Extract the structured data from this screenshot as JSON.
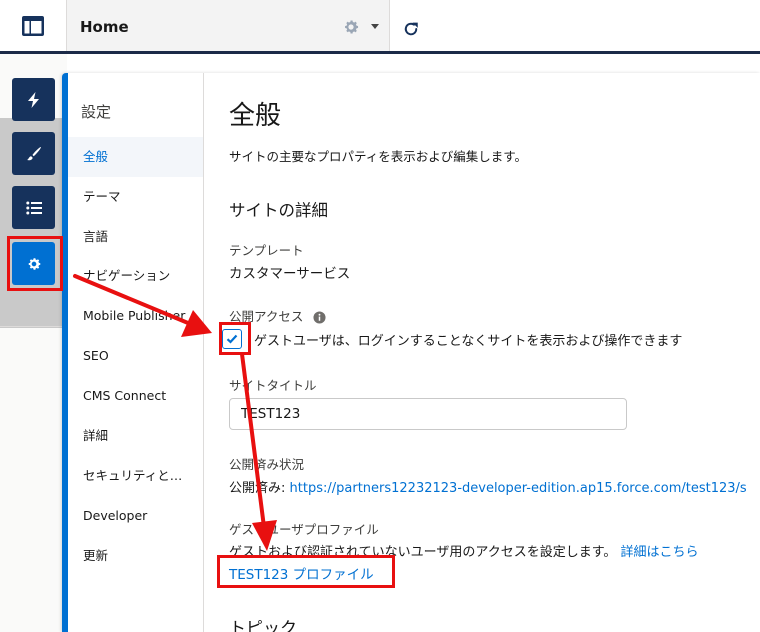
{
  "topbar": {
    "home_label": "Home"
  },
  "rail": {
    "items": [
      {
        "icon": "lightning-icon"
      },
      {
        "icon": "brush-icon"
      },
      {
        "icon": "list-icon"
      },
      {
        "icon": "gear-icon",
        "active": true
      }
    ]
  },
  "settings_nav": {
    "title": "設定",
    "items": [
      {
        "label": "全般",
        "active": true
      },
      {
        "label": "テーマ"
      },
      {
        "label": "言語"
      },
      {
        "label": "ナビゲーション"
      },
      {
        "label": "Mobile Publisher"
      },
      {
        "label": "SEO"
      },
      {
        "label": "CMS Connect"
      },
      {
        "label": "詳細"
      },
      {
        "label": "セキュリティと…"
      },
      {
        "label": "Developer"
      },
      {
        "label": "更新"
      }
    ]
  },
  "general": {
    "title": "全般",
    "description": "サイトの主要なプロパティを表示および編集します。",
    "section_title": "サイトの詳細",
    "template_label": "テンプレート",
    "template_value": "カスタマーサービス",
    "public_access_label": "公開アクセス",
    "public_access_checkbox_label": "ゲストユーザは、ログインすることなくサイトを表示および操作できます",
    "public_access_checked": true,
    "site_title_label": "サイトタイトル",
    "site_title_value": "TEST123",
    "publish_status_label": "公開済み状況",
    "publish_status_prefix": "公開済み:",
    "publish_status_url": "https://partners12232123-developer-edition.ap15.force.com/test123/s",
    "guest_profile_label": "ゲストユーザプロファイル",
    "guest_profile_description": "ゲストおよび認証されていないユーザ用のアクセスを設定します。",
    "guest_profile_details_link": "詳細はこちら",
    "guest_profile_link": "TEST123 プロファイル",
    "topics_title": "トピック"
  },
  "colors": {
    "brand_blue": "#0070d2",
    "navy": "#16325c",
    "annotation_red": "#e81010"
  }
}
